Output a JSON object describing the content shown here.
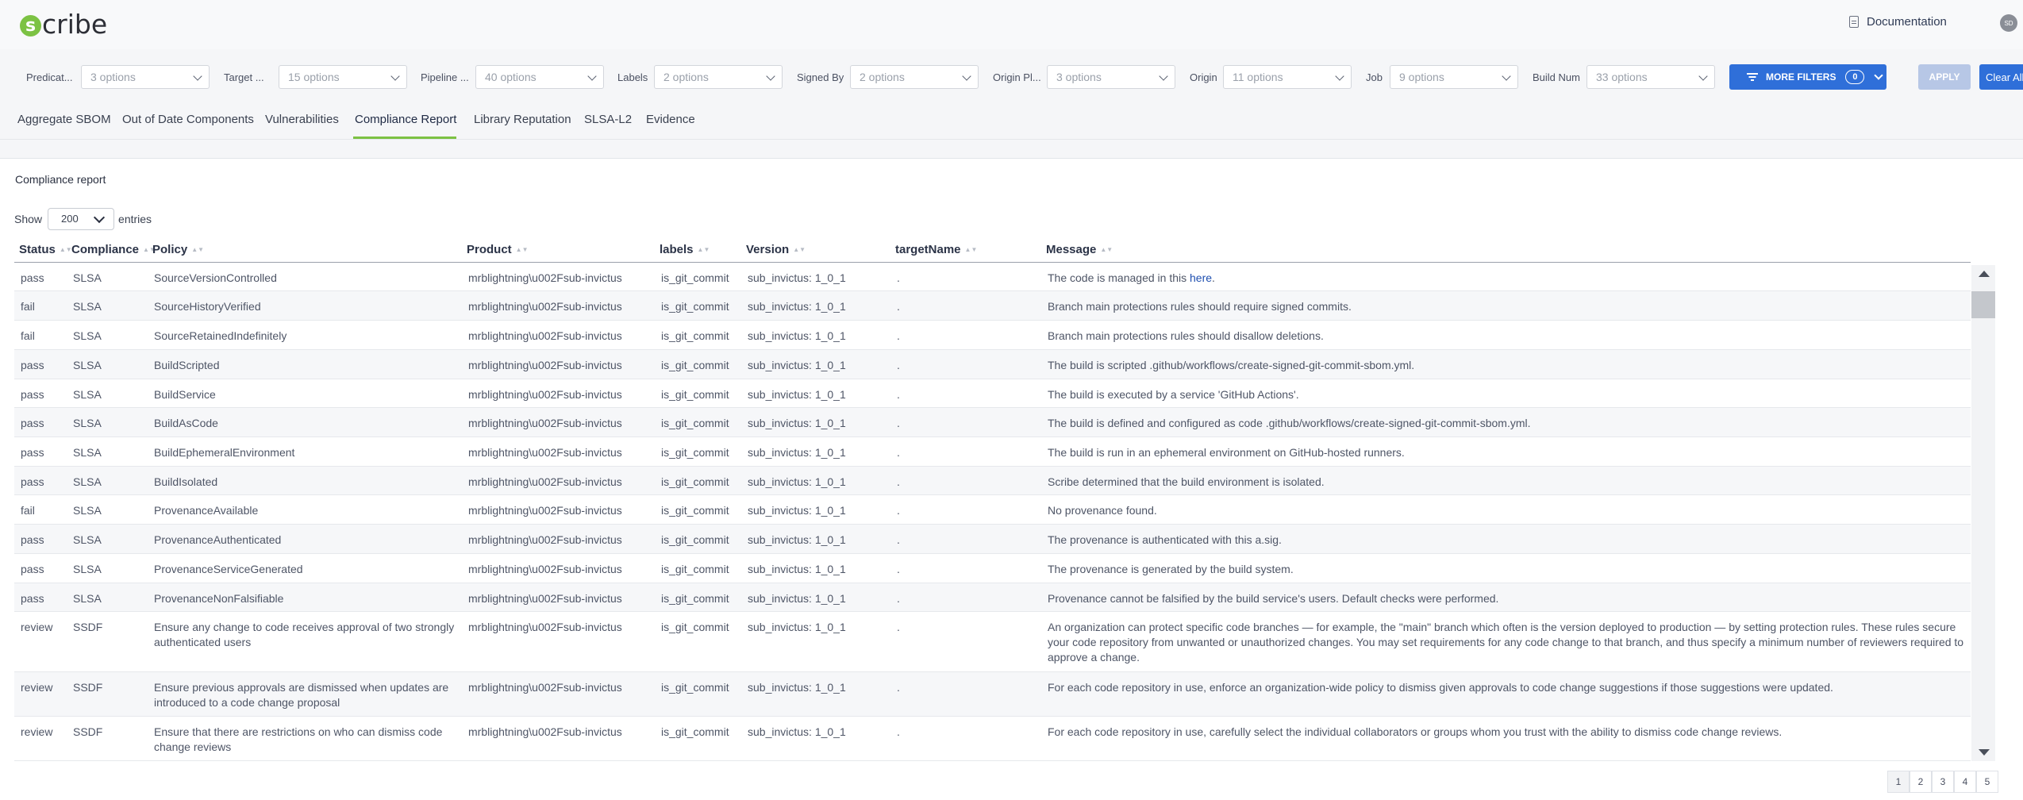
{
  "header": {
    "logo_text": "cribe",
    "logo_letter": "s",
    "documentation_label": "Documentation",
    "avatar_initials": "SD"
  },
  "filters": [
    {
      "label": "Predicat...",
      "value": "3 options"
    },
    {
      "label": "Target ...",
      "value": "15 options"
    },
    {
      "label": "Pipeline ...",
      "value": "40 options"
    },
    {
      "label": "Labels",
      "value": "2 options"
    },
    {
      "label": "Signed By",
      "value": "2 options"
    },
    {
      "label": "Origin Pl...",
      "value": "3 options"
    },
    {
      "label": "Origin",
      "value": "11 options"
    },
    {
      "label": "Job",
      "value": "9 options"
    },
    {
      "label": "Build Num",
      "value": "33 options"
    }
  ],
  "more_filters": {
    "label": "MORE FILTERS",
    "count": "0"
  },
  "apply_label": "APPLY",
  "clear_label": "Clear All",
  "tabs": [
    {
      "label": "Aggregate SBOM"
    },
    {
      "label": "Out of Date Components"
    },
    {
      "label": "Vulnerabilities"
    },
    {
      "label": "Compliance Report"
    },
    {
      "label": "Library Reputation"
    },
    {
      "label": "SLSA-L2"
    },
    {
      "label": "Evidence"
    }
  ],
  "active_tab": "Compliance Report",
  "report": {
    "title": "Compliance report",
    "show_prefix": "Show",
    "show_value": "200",
    "show_suffix": "entries",
    "columns": [
      "Status",
      "Compliance",
      "Policy",
      "Product",
      "labels",
      "Version",
      "targetName",
      "Message"
    ],
    "rows": [
      {
        "status": "pass",
        "compliance": "SLSA",
        "policy": "SourceVersionControlled",
        "product": "mrblightning\\u002Fsub-invictus",
        "labels": "is_git_commit",
        "version": "sub_invictus: 1_0_1",
        "target": ".",
        "message": "The code is managed in this ",
        "link": "here",
        "message_end": "."
      },
      {
        "status": "fail",
        "compliance": "SLSA",
        "policy": "SourceHistoryVerified",
        "product": "mrblightning\\u002Fsub-invictus",
        "labels": "is_git_commit",
        "version": "sub_invictus: 1_0_1",
        "target": ".",
        "message": "Branch main protections rules should require signed commits."
      },
      {
        "status": "fail",
        "compliance": "SLSA",
        "policy": "SourceRetainedIndefinitely",
        "product": "mrblightning\\u002Fsub-invictus",
        "labels": "is_git_commit",
        "version": "sub_invictus: 1_0_1",
        "target": ".",
        "message": "Branch main protections rules should disallow deletions."
      },
      {
        "status": "pass",
        "compliance": "SLSA",
        "policy": "BuildScripted",
        "product": "mrblightning\\u002Fsub-invictus",
        "labels": "is_git_commit",
        "version": "sub_invictus: 1_0_1",
        "target": ".",
        "message": "The build is scripted .github/workflows/create-signed-git-commit-sbom.yml."
      },
      {
        "status": "pass",
        "compliance": "SLSA",
        "policy": "BuildService",
        "product": "mrblightning\\u002Fsub-invictus",
        "labels": "is_git_commit",
        "version": "sub_invictus: 1_0_1",
        "target": ".",
        "message": "The build is executed by a service 'GitHub Actions'."
      },
      {
        "status": "pass",
        "compliance": "SLSA",
        "policy": "BuildAsCode",
        "product": "mrblightning\\u002Fsub-invictus",
        "labels": "is_git_commit",
        "version": "sub_invictus: 1_0_1",
        "target": ".",
        "message": "The build is defined and configured as code .github/workflows/create-signed-git-commit-sbom.yml."
      },
      {
        "status": "pass",
        "compliance": "SLSA",
        "policy": "BuildEphemeralEnvironment",
        "product": "mrblightning\\u002Fsub-invictus",
        "labels": "is_git_commit",
        "version": "sub_invictus: 1_0_1",
        "target": ".",
        "message": "The build is run in an ephemeral environment on GitHub-hosted runners."
      },
      {
        "status": "pass",
        "compliance": "SLSA",
        "policy": "BuildIsolated",
        "product": "mrblightning\\u002Fsub-invictus",
        "labels": "is_git_commit",
        "version": "sub_invictus: 1_0_1",
        "target": ".",
        "message": "Scribe determined that the build environment is isolated."
      },
      {
        "status": "fail",
        "compliance": "SLSA",
        "policy": "ProvenanceAvailable",
        "product": "mrblightning\\u002Fsub-invictus",
        "labels": "is_git_commit",
        "version": "sub_invictus: 1_0_1",
        "target": ".",
        "message": "No provenance found."
      },
      {
        "status": "pass",
        "compliance": "SLSA",
        "policy": "ProvenanceAuthenticated",
        "product": "mrblightning\\u002Fsub-invictus",
        "labels": "is_git_commit",
        "version": "sub_invictus: 1_0_1",
        "target": ".",
        "message": "The provenance is authenticated with this a.sig."
      },
      {
        "status": "pass",
        "compliance": "SLSA",
        "policy": "ProvenanceServiceGenerated",
        "product": "mrblightning\\u002Fsub-invictus",
        "labels": "is_git_commit",
        "version": "sub_invictus: 1_0_1",
        "target": ".",
        "message": "The provenance is generated by the build system."
      },
      {
        "status": "pass",
        "compliance": "SLSA",
        "policy": "ProvenanceNonFalsifiable",
        "product": "mrblightning\\u002Fsub-invictus",
        "labels": "is_git_commit",
        "version": "sub_invictus: 1_0_1",
        "target": ".",
        "message": "Provenance cannot be falsified by the build service's users. Default checks were performed."
      },
      {
        "status": "review",
        "compliance": "SSDF",
        "policy": "Ensure any change to code receives approval of two strongly authenticated users",
        "product": "mrblightning\\u002Fsub-invictus",
        "labels": "is_git_commit",
        "version": "sub_invictus: 1_0_1",
        "target": ".",
        "message": "An organization can protect specific code branches — for example, the \"main\" branch which often is the version deployed to production — by setting protection rules. These rules secure your code repository from unwanted or unauthorized changes. You may set requirements for any code change to that branch, and thus specify a minimum number of reviewers required to approve a change."
      },
      {
        "status": "review",
        "compliance": "SSDF",
        "policy": "Ensure previous approvals are dismissed when updates are introduced to a code change proposal",
        "product": "mrblightning\\u002Fsub-invictus",
        "labels": "is_git_commit",
        "version": "sub_invictus: 1_0_1",
        "target": ".",
        "message": "For each code repository in use, enforce an organization-wide policy to dismiss given approvals to code change suggestions if those suggestions were updated."
      },
      {
        "status": "review",
        "compliance": "SSDF",
        "policy": "Ensure that there are restrictions on who can dismiss code change reviews",
        "product": "mrblightning\\u002Fsub-invictus",
        "labels": "is_git_commit",
        "version": "sub_invictus: 1_0_1",
        "target": ".",
        "message": "For each code repository in use, carefully select the individual collaborators or groups whom you trust with the ability to dismiss code change reviews."
      }
    ]
  },
  "pagination": [
    "1",
    "2",
    "3",
    "4",
    "5"
  ],
  "colors": {
    "accent": "#2f6fd9",
    "brand_green": "#7cc243"
  }
}
